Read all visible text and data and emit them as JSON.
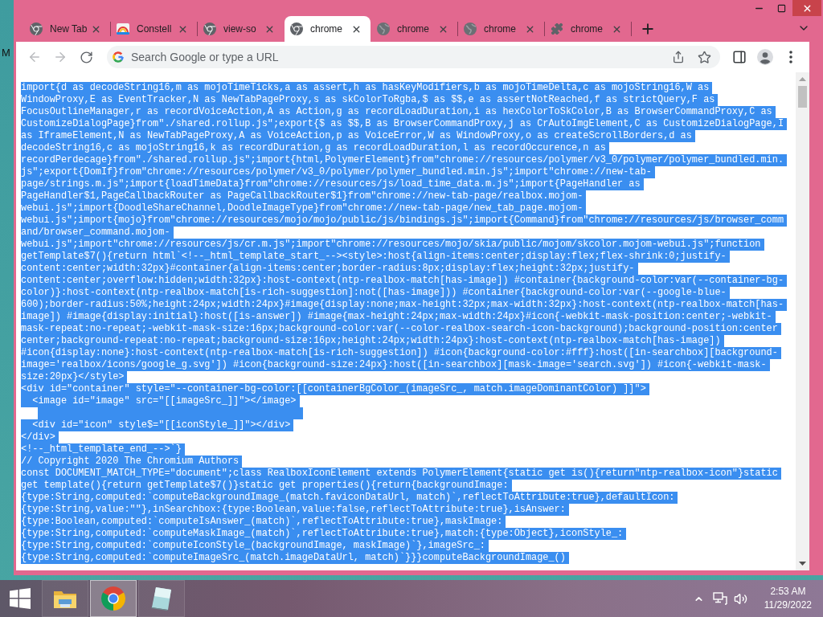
{
  "desktop": {
    "icon_label": "M"
  },
  "tabs": [
    {
      "label": "New Tab",
      "kind": "chrome",
      "selected": false
    },
    {
      "label": "Constell",
      "kind": "image",
      "selected": false
    },
    {
      "label": "view-so",
      "kind": "chrome",
      "selected": false
    },
    {
      "label": "chrome",
      "kind": "chrome",
      "selected": true
    },
    {
      "label": "chrome",
      "kind": "globe",
      "selected": false
    },
    {
      "label": "chrome",
      "kind": "globe",
      "selected": false
    },
    {
      "label": "chrome",
      "kind": "extension",
      "selected": false
    }
  ],
  "toolbar": {
    "nav_buttons": [
      {
        "kind": "back",
        "disabled": true
      },
      {
        "kind": "forward",
        "disabled": true
      },
      {
        "kind": "reload",
        "disabled": false
      }
    ],
    "omnibox": {
      "placeholder": "Search Google or type a URL"
    }
  },
  "code": {
    "selected": true,
    "lines": [
      {
        "kind": "text",
        "text": "import{d as decodeString16,m as mojoTimeTicks,a as assert,h as hasKeyModifiers,b as mojoTimeDelta,c as mojoString16,W as"
      },
      {
        "kind": "text",
        "text": "WindowProxy,E as EventTracker,N as NewTabPageProxy,s as skColorToRgba,$ as $$,e as assertNotReached,f as strictQuery,F as"
      },
      {
        "kind": "text",
        "text": "FocusOutlineManager,r as recordVoiceAction,A as Action,g as recordLoadDuration,i as hexColorToSkColor,B as BrowserCommandProxy,C as"
      },
      {
        "kind": "text",
        "text": "CustomizeDialogPage}from\"./shared.rollup.js\";export{$ as $$,B as BrowserCommandProxy,j as CrAutoImgElement,C as CustomizeDialogPage,I"
      },
      {
        "kind": "text",
        "text": "as IframeElement,N as NewTabPageProxy,A as VoiceAction,p as VoiceError,W as WindowProxy,o as createScrollBorders,d as"
      },
      {
        "kind": "text",
        "text": "decodeString16,c as mojoString16,k as recordDuration,g as recordLoadDuration,l as recordOccurence,n as"
      },
      {
        "kind": "text",
        "text": "recordPerdecage}from\"./shared.rollup.js\";import{html,PolymerElement}from\"chrome://resources/polymer/v3_0/polymer/polymer_bundled.min."
      },
      {
        "kind": "text",
        "text": "js\";export{DomIf}from\"chrome://resources/polymer/v3_0/polymer/polymer_bundled.min.js\";import\"chrome://new-tab-"
      },
      {
        "kind": "text",
        "text": "page/strings.m.js\";import{loadTimeData}from\"chrome://resources/js/load_time_data.m.js\";import{PageHandler as"
      },
      {
        "kind": "text",
        "text": "PageHandler$1,PageCallbackRouter as PageCallbackRouter$1}from\"chrome://new-tab-page/realbox.mojom-"
      },
      {
        "kind": "text",
        "text": "webui.js\";import{DoodleShareChannel,DoodleImageType}from\"chrome://new-tab-page/new_tab_page.mojom-"
      },
      {
        "kind": "text",
        "text": "webui.js\";import{mojo}from\"chrome://resources/mojo/mojo/public/js/bindings.js\";import{Command}from\"chrome://resources/js/browser_comm"
      },
      {
        "kind": "text",
        "text": "and/browser_command.mojom-"
      },
      {
        "kind": "text",
        "text": "webui.js\";import\"chrome://resources/js/cr.m.js\";import\"chrome://resources/mojo/skia/public/mojom/skcolor.mojom-webui.js\";function"
      },
      {
        "kind": "text",
        "text": "getTemplate$7(){return html`<!--_html_template_start_--><style>:host{align-items:center;display:flex;flex-shrink:0;justify-"
      },
      {
        "kind": "text",
        "text": "content:center;width:32px}#container{align-items:center;border-radius:8px;display:flex;height:32px;justify-"
      },
      {
        "kind": "text",
        "text": "content:center;overflow:hidden;width:32px}:host-context(ntp-realbox-match[has-image]) #container{background-color:var(--container-bg-"
      },
      {
        "kind": "text",
        "text": "color)}:host-context(ntp-realbox-match[is-rich-suggestion]:not([has-image])) #container{background-color:var(--google-blue-"
      },
      {
        "kind": "text",
        "text": "600);border-radius:50%;height:24px;width:24px}#image{display:none;max-height:32px;max-width:32px}:host-context(ntp-realbox-match[has-"
      },
      {
        "kind": "text",
        "text": "image]) #image{display:initial}:host([is-answer]) #image{max-height:24px;max-width:24px}#icon{-webkit-mask-position:center;-webkit-"
      },
      {
        "kind": "text",
        "text": "mask-repeat:no-repeat;-webkit-mask-size:16px;background-color:var(--color-realbox-search-icon-background);background-position:center"
      },
      {
        "kind": "text",
        "text": "center;background-repeat:no-repeat;background-size:16px;height:24px;width:24px}:host-context(ntp-realbox-match[has-image])"
      },
      {
        "kind": "text",
        "text": "#icon{display:none}:host-context(ntp-realbox-match[is-rich-suggestion]) #icon{background-color:#fff}:host([in-searchbox][background-"
      },
      {
        "kind": "text",
        "text": "image='realbox/icons/google_g.svg']) #icon{background-size:24px}:host([in-searchbox][mask-image='search.svg']) #icon{-webkit-mask-"
      },
      {
        "kind": "text",
        "text": "size:20px}</style>"
      },
      {
        "kind": "text",
        "text": "<div id=\"container\" style=\"--container-bg-color:[[containerBgColor_(imageSrc_, match.imageDominantColor) ]]\">"
      },
      {
        "kind": "text",
        "text": "  <image id=\"image\" src=\"[[imageSrc_]]\"></image>"
      },
      {
        "kind": "blank"
      },
      {
        "kind": "text",
        "text": "  <div id=\"icon\" style$=\"[[iconStyle_]]\"></div>"
      },
      {
        "kind": "text",
        "text": "</div>"
      },
      {
        "kind": "text",
        "text": "<!--_html_template_end_-->`}"
      },
      {
        "kind": "text",
        "text": "// Copyright 2020 The Chromium Authors"
      },
      {
        "kind": "text",
        "text": "const DOCUMENT_MATCH_TYPE=\"document\";class RealboxIconElement extends PolymerElement{static get is(){return\"ntp-realbox-icon\"}static"
      },
      {
        "kind": "text",
        "text": "get template(){return getTemplate$7()}static get properties(){return{backgroundImage:"
      },
      {
        "kind": "text",
        "text": "{type:String,computed:`computeBackgroundImage_(match.faviconDataUrl, match)`,reflectToAttribute:true},defaultIcon:"
      },
      {
        "kind": "text",
        "text": "{type:String,value:\"\"},inSearchbox:{type:Boolean,value:false,reflectToAttribute:true},isAnswer:"
      },
      {
        "kind": "text",
        "text": "{type:Boolean,computed:`computeIsAnswer_(match)`,reflectToAttribute:true},maskImage:"
      },
      {
        "kind": "text",
        "text": "{type:String,computed:`computeMaskImage_(match)`,reflectToAttribute:true},match:{type:Object},iconStyle_:"
      },
      {
        "kind": "text",
        "text": "{type:String,computed:`computeIconStyle_(backgroundImage, maskImage)`},imageSrc_:"
      },
      {
        "kind": "text",
        "text": "{type:String,computed:`computeImageSrc_(match.imageDataUrl, match)`}}}computeBackgroundImage_()"
      }
    ]
  },
  "taskbar": {
    "apps": [
      {
        "kind": "explorer",
        "selected": false
      },
      {
        "kind": "chrome",
        "selected": true
      },
      {
        "kind": "notes",
        "selected": false
      }
    ],
    "clock": {
      "time": "2:53 AM",
      "date": "11/29/2022"
    }
  }
}
